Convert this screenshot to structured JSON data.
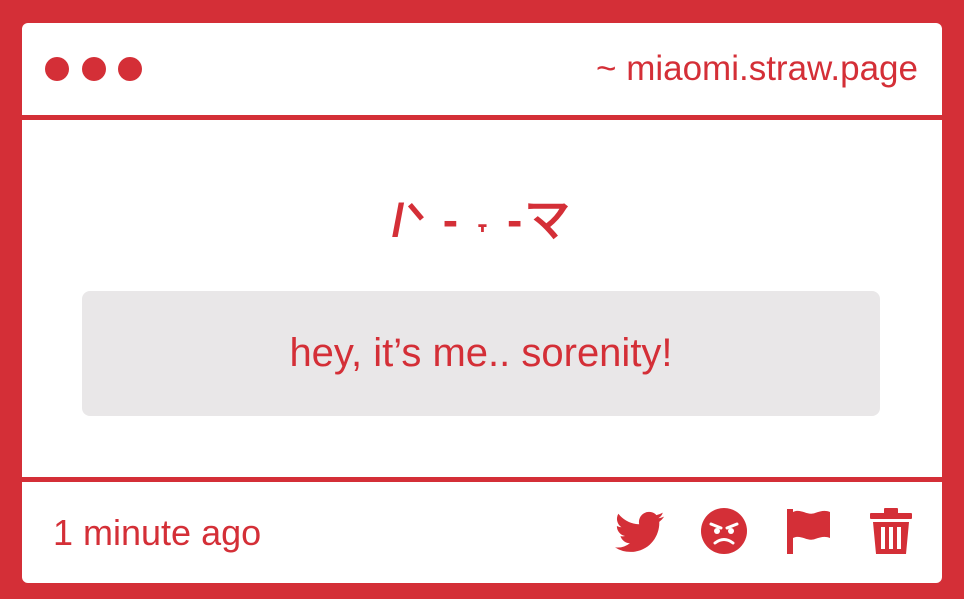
{
  "window": {
    "site_url": "~ miaomi.straw.page"
  },
  "post": {
    "kaomoji": "/ᐠ - ˕ -マ",
    "message": "hey, it’s me.. sorenity!",
    "timestamp": "1 minute ago"
  },
  "actions": [
    {
      "name": "share-twitter",
      "icon": "twitter-bird-icon"
    },
    {
      "name": "react-angry",
      "icon": "angry-face-icon"
    },
    {
      "name": "report",
      "icon": "flag-icon"
    },
    {
      "name": "delete",
      "icon": "trash-icon"
    }
  ],
  "colors": {
    "accent": "#d42f37",
    "background": "#ffffff",
    "message_box": "#e9e7e8"
  }
}
